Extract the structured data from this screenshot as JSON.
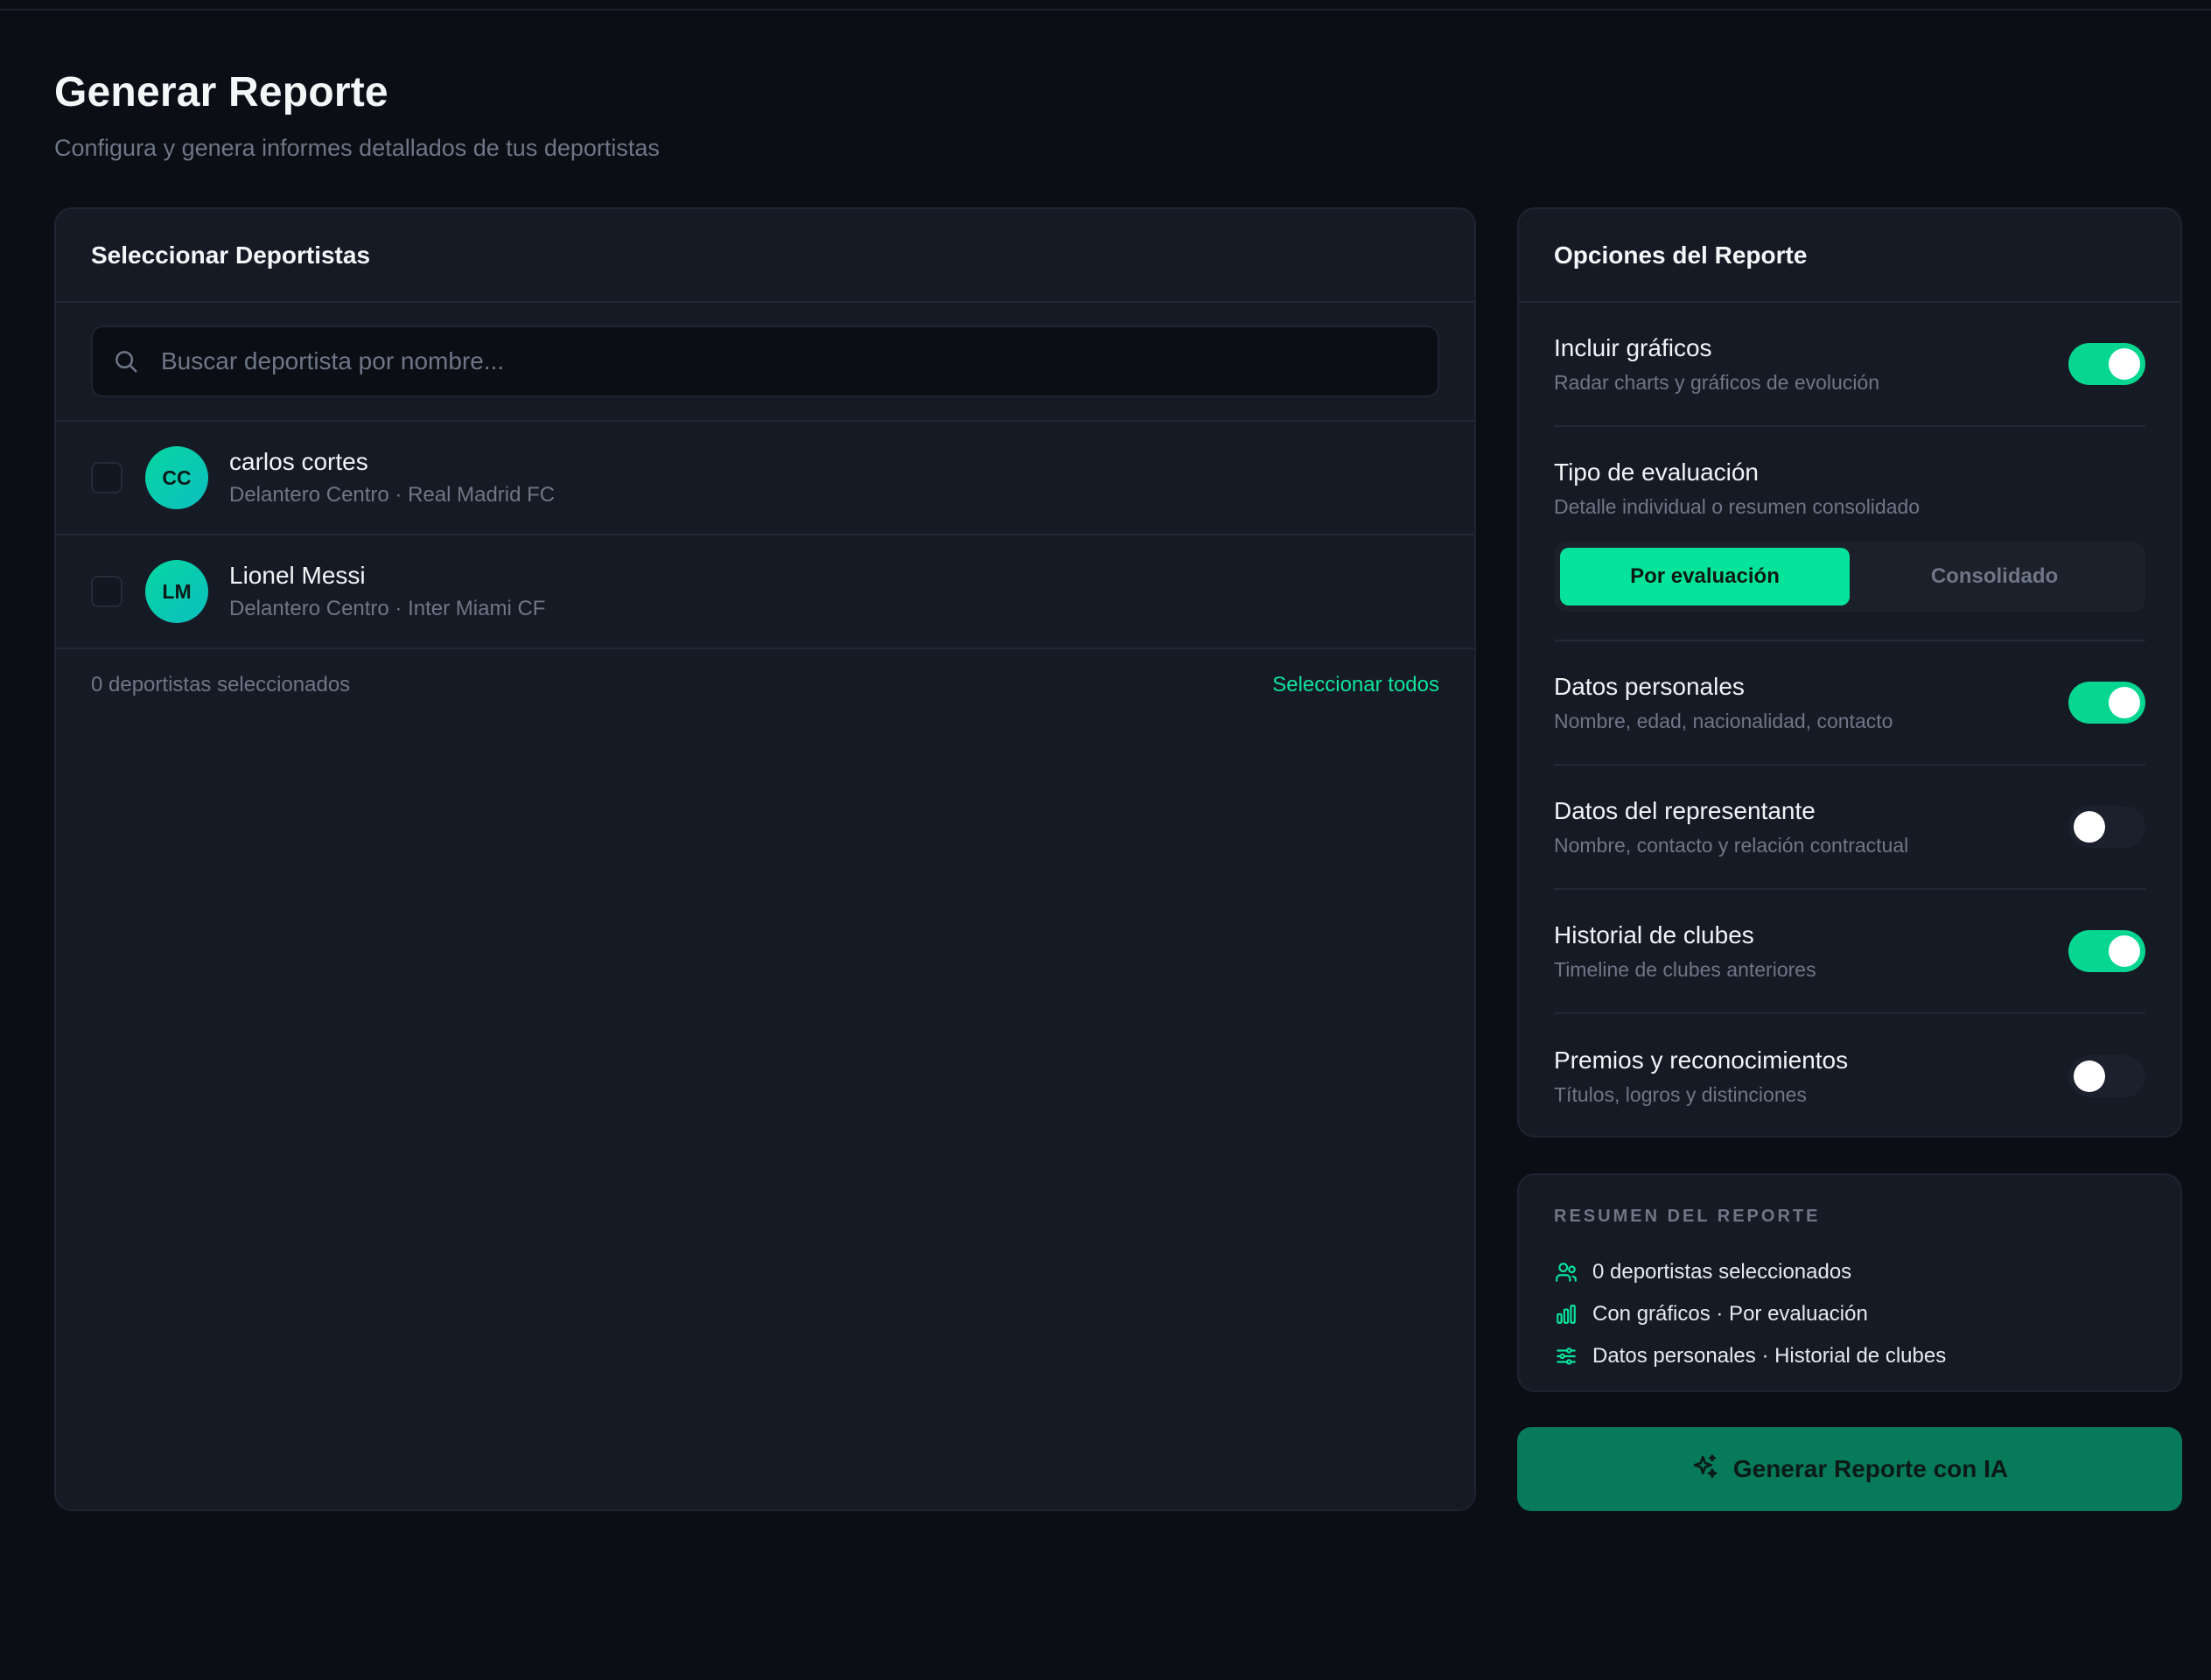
{
  "page": {
    "title": "Generar Reporte",
    "subtitle": "Configura y genera informes detallados de tus deportistas"
  },
  "athletes_panel": {
    "title": "Seleccionar Deportistas",
    "search": {
      "placeholder": "Buscar deportista por nombre...",
      "value": ""
    },
    "items": [
      {
        "initials": "CC",
        "name": "carlos cortes",
        "meta": "Delantero Centro · Real Madrid FC",
        "checked": false
      },
      {
        "initials": "LM",
        "name": "Lionel Messi",
        "meta": "Delantero Centro · Inter Miami CF",
        "checked": false
      }
    ],
    "selected_count": "0 deportistas seleccionados",
    "select_all": "Seleccionar todos"
  },
  "options_panel": {
    "title": "Opciones del Reporte",
    "options": [
      {
        "title": "Incluir gráficos",
        "desc": "Radar charts y gráficos de evolución",
        "enabled": true
      },
      {
        "title": "Datos personales",
        "desc": "Nombre, edad, nacionalidad, contacto",
        "enabled": true
      },
      {
        "title": "Datos del representante",
        "desc": "Nombre, contacto y relación contractual",
        "enabled": false
      },
      {
        "title": "Historial de clubes",
        "desc": "Timeline de clubes anteriores",
        "enabled": true
      },
      {
        "title": "Premios y reconocimientos",
        "desc": "Títulos, logros y distinciones",
        "enabled": false
      }
    ],
    "evaluation": {
      "title": "Tipo de evaluación",
      "desc": "Detalle individual o resumen consolidado",
      "options": [
        "Por evaluación",
        "Consolidado"
      ],
      "selected": "Por evaluación"
    }
  },
  "summary": {
    "title": "RESUMEN DEL REPORTE",
    "lines": [
      {
        "icon": "users-icon",
        "text": "0 deportistas seleccionados"
      },
      {
        "icon": "bar-chart-icon",
        "text": "Con gráficos · Por evaluación"
      },
      {
        "icon": "sliders-icon",
        "text": "Datos personales · Historial de clubes"
      }
    ]
  },
  "generate_button": {
    "label": "Generar Reporte con IA",
    "icon": "sparkles-icon"
  },
  "colors": {
    "background": "#0b0e15",
    "card": "#161a25",
    "accent": "#06e39a",
    "button": "#077a5a",
    "muted": "#6e7687"
  }
}
